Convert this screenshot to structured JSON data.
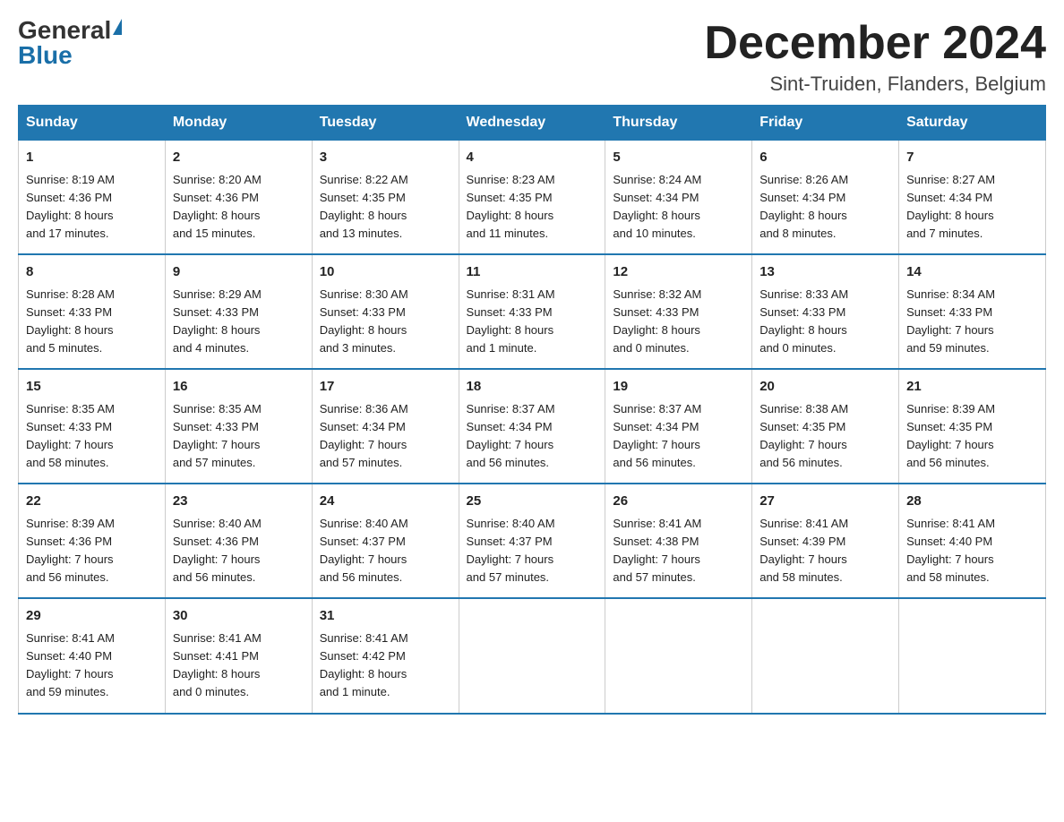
{
  "header": {
    "logo_general": "General",
    "logo_blue": "Blue",
    "month_title": "December 2024",
    "location": "Sint-Truiden, Flanders, Belgium"
  },
  "days_of_week": [
    "Sunday",
    "Monday",
    "Tuesday",
    "Wednesday",
    "Thursday",
    "Friday",
    "Saturday"
  ],
  "weeks": [
    [
      {
        "day": "1",
        "info": "Sunrise: 8:19 AM\nSunset: 4:36 PM\nDaylight: 8 hours\nand 17 minutes."
      },
      {
        "day": "2",
        "info": "Sunrise: 8:20 AM\nSunset: 4:36 PM\nDaylight: 8 hours\nand 15 minutes."
      },
      {
        "day": "3",
        "info": "Sunrise: 8:22 AM\nSunset: 4:35 PM\nDaylight: 8 hours\nand 13 minutes."
      },
      {
        "day": "4",
        "info": "Sunrise: 8:23 AM\nSunset: 4:35 PM\nDaylight: 8 hours\nand 11 minutes."
      },
      {
        "day": "5",
        "info": "Sunrise: 8:24 AM\nSunset: 4:34 PM\nDaylight: 8 hours\nand 10 minutes."
      },
      {
        "day": "6",
        "info": "Sunrise: 8:26 AM\nSunset: 4:34 PM\nDaylight: 8 hours\nand 8 minutes."
      },
      {
        "day": "7",
        "info": "Sunrise: 8:27 AM\nSunset: 4:34 PM\nDaylight: 8 hours\nand 7 minutes."
      }
    ],
    [
      {
        "day": "8",
        "info": "Sunrise: 8:28 AM\nSunset: 4:33 PM\nDaylight: 8 hours\nand 5 minutes."
      },
      {
        "day": "9",
        "info": "Sunrise: 8:29 AM\nSunset: 4:33 PM\nDaylight: 8 hours\nand 4 minutes."
      },
      {
        "day": "10",
        "info": "Sunrise: 8:30 AM\nSunset: 4:33 PM\nDaylight: 8 hours\nand 3 minutes."
      },
      {
        "day": "11",
        "info": "Sunrise: 8:31 AM\nSunset: 4:33 PM\nDaylight: 8 hours\nand 1 minute."
      },
      {
        "day": "12",
        "info": "Sunrise: 8:32 AM\nSunset: 4:33 PM\nDaylight: 8 hours\nand 0 minutes."
      },
      {
        "day": "13",
        "info": "Sunrise: 8:33 AM\nSunset: 4:33 PM\nDaylight: 8 hours\nand 0 minutes."
      },
      {
        "day": "14",
        "info": "Sunrise: 8:34 AM\nSunset: 4:33 PM\nDaylight: 7 hours\nand 59 minutes."
      }
    ],
    [
      {
        "day": "15",
        "info": "Sunrise: 8:35 AM\nSunset: 4:33 PM\nDaylight: 7 hours\nand 58 minutes."
      },
      {
        "day": "16",
        "info": "Sunrise: 8:35 AM\nSunset: 4:33 PM\nDaylight: 7 hours\nand 57 minutes."
      },
      {
        "day": "17",
        "info": "Sunrise: 8:36 AM\nSunset: 4:34 PM\nDaylight: 7 hours\nand 57 minutes."
      },
      {
        "day": "18",
        "info": "Sunrise: 8:37 AM\nSunset: 4:34 PM\nDaylight: 7 hours\nand 56 minutes."
      },
      {
        "day": "19",
        "info": "Sunrise: 8:37 AM\nSunset: 4:34 PM\nDaylight: 7 hours\nand 56 minutes."
      },
      {
        "day": "20",
        "info": "Sunrise: 8:38 AM\nSunset: 4:35 PM\nDaylight: 7 hours\nand 56 minutes."
      },
      {
        "day": "21",
        "info": "Sunrise: 8:39 AM\nSunset: 4:35 PM\nDaylight: 7 hours\nand 56 minutes."
      }
    ],
    [
      {
        "day": "22",
        "info": "Sunrise: 8:39 AM\nSunset: 4:36 PM\nDaylight: 7 hours\nand 56 minutes."
      },
      {
        "day": "23",
        "info": "Sunrise: 8:40 AM\nSunset: 4:36 PM\nDaylight: 7 hours\nand 56 minutes."
      },
      {
        "day": "24",
        "info": "Sunrise: 8:40 AM\nSunset: 4:37 PM\nDaylight: 7 hours\nand 56 minutes."
      },
      {
        "day": "25",
        "info": "Sunrise: 8:40 AM\nSunset: 4:37 PM\nDaylight: 7 hours\nand 57 minutes."
      },
      {
        "day": "26",
        "info": "Sunrise: 8:41 AM\nSunset: 4:38 PM\nDaylight: 7 hours\nand 57 minutes."
      },
      {
        "day": "27",
        "info": "Sunrise: 8:41 AM\nSunset: 4:39 PM\nDaylight: 7 hours\nand 58 minutes."
      },
      {
        "day": "28",
        "info": "Sunrise: 8:41 AM\nSunset: 4:40 PM\nDaylight: 7 hours\nand 58 minutes."
      }
    ],
    [
      {
        "day": "29",
        "info": "Sunrise: 8:41 AM\nSunset: 4:40 PM\nDaylight: 7 hours\nand 59 minutes."
      },
      {
        "day": "30",
        "info": "Sunrise: 8:41 AM\nSunset: 4:41 PM\nDaylight: 8 hours\nand 0 minutes."
      },
      {
        "day": "31",
        "info": "Sunrise: 8:41 AM\nSunset: 4:42 PM\nDaylight: 8 hours\nand 1 minute."
      },
      {
        "day": "",
        "info": ""
      },
      {
        "day": "",
        "info": ""
      },
      {
        "day": "",
        "info": ""
      },
      {
        "day": "",
        "info": ""
      }
    ]
  ]
}
